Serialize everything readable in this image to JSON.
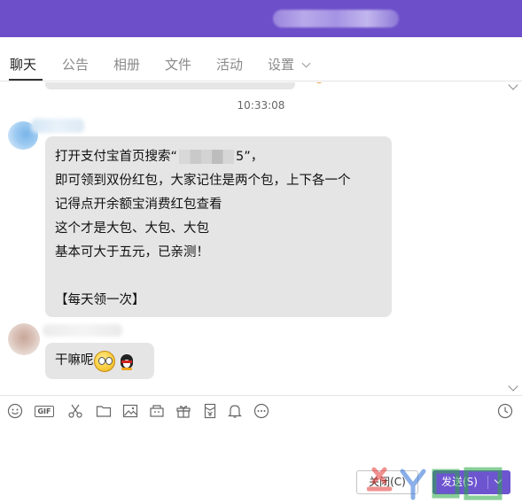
{
  "tabs": [
    {
      "label": "聊天",
      "active": true
    },
    {
      "label": "公告"
    },
    {
      "label": "相册"
    },
    {
      "label": "文件"
    },
    {
      "label": "活动"
    },
    {
      "label": "设置"
    }
  ],
  "chat": {
    "timestamp": "10:33:08",
    "message1": {
      "line1_pre": "打开支付宝首页搜索“",
      "line1_post": "5”，",
      "line2": "即可领到双份红包，大家记住是两个包，上下各一个",
      "line3": "记得点开余额宝消费红包查看",
      "line4": "这个才是大包、大包、大包",
      "line5": "基本可大于五元，已亲测！",
      "line7": "【每天领一次】"
    },
    "message2": {
      "text": "干嘛呢"
    }
  },
  "toolbar": {
    "icons": [
      "emoji-icon",
      "gif-icon",
      "scissors-icon",
      "folder-icon",
      "image-icon",
      "gift-box-icon",
      "gift-icon",
      "red-packet-icon",
      "bell-icon",
      "more-icon",
      "history-clock-icon"
    ],
    "gif_label": "GIF"
  },
  "buttons": {
    "close_label": "关闭(C)",
    "send_label": "发送(S)"
  },
  "colors": {
    "title_bar": "#6d4fc9",
    "send_button": "#6d55d0",
    "bubble": "#e5e5e5"
  }
}
